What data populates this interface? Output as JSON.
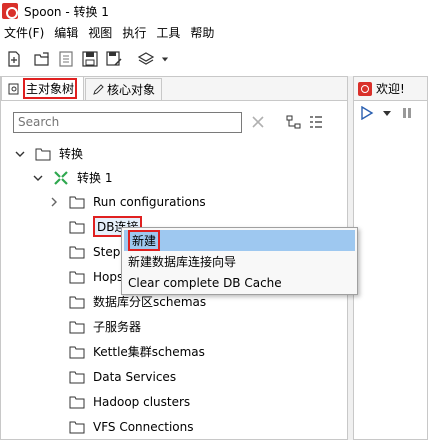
{
  "window": {
    "title": "Spoon - 转换 1",
    "app_icon": "spoon-icon"
  },
  "menu": [
    "文件(F)",
    "编辑",
    "视图",
    "执行",
    "工具",
    "帮助"
  ],
  "toolbar": {
    "icons": [
      "new-file-icon",
      "open-icon",
      "explore-repo-icon",
      "save-icon",
      "save-as-icon",
      "perspective-icon",
      "dropdown-arrow-icon"
    ]
  },
  "left_panel": {
    "tabs": [
      {
        "label": "主对象树",
        "icon": "tree-icon",
        "active": true,
        "highlighted": true
      },
      {
        "label": "核心对象",
        "icon": "pencil-icon",
        "active": false
      }
    ],
    "search": {
      "placeholder": "Search",
      "value": ""
    },
    "tree": {
      "root": "转换",
      "transformation": "转换 1",
      "items": [
        {
          "label": "Run configurations",
          "expandable": true
        },
        {
          "label": "DB连接",
          "highlighted": true
        },
        {
          "label": "Steps"
        },
        {
          "label": "Hops"
        },
        {
          "label": "数据库分区schemas"
        },
        {
          "label": "子服务器"
        },
        {
          "label": "Kettle集群schemas"
        },
        {
          "label": "Data Services"
        },
        {
          "label": "Hadoop clusters"
        },
        {
          "label": "VFS Connections"
        }
      ]
    }
  },
  "context_menu": {
    "items": [
      {
        "label": "新建",
        "highlighted": true
      },
      {
        "label": "新建数据库连接向导"
      },
      {
        "label": "Clear complete DB Cache"
      }
    ]
  },
  "right_panel": {
    "tab_label": "欢迎!"
  },
  "colors": {
    "highlight_box": "#e02020",
    "selection": "#9ec8f0",
    "transform_icon": "#2fa84f"
  }
}
